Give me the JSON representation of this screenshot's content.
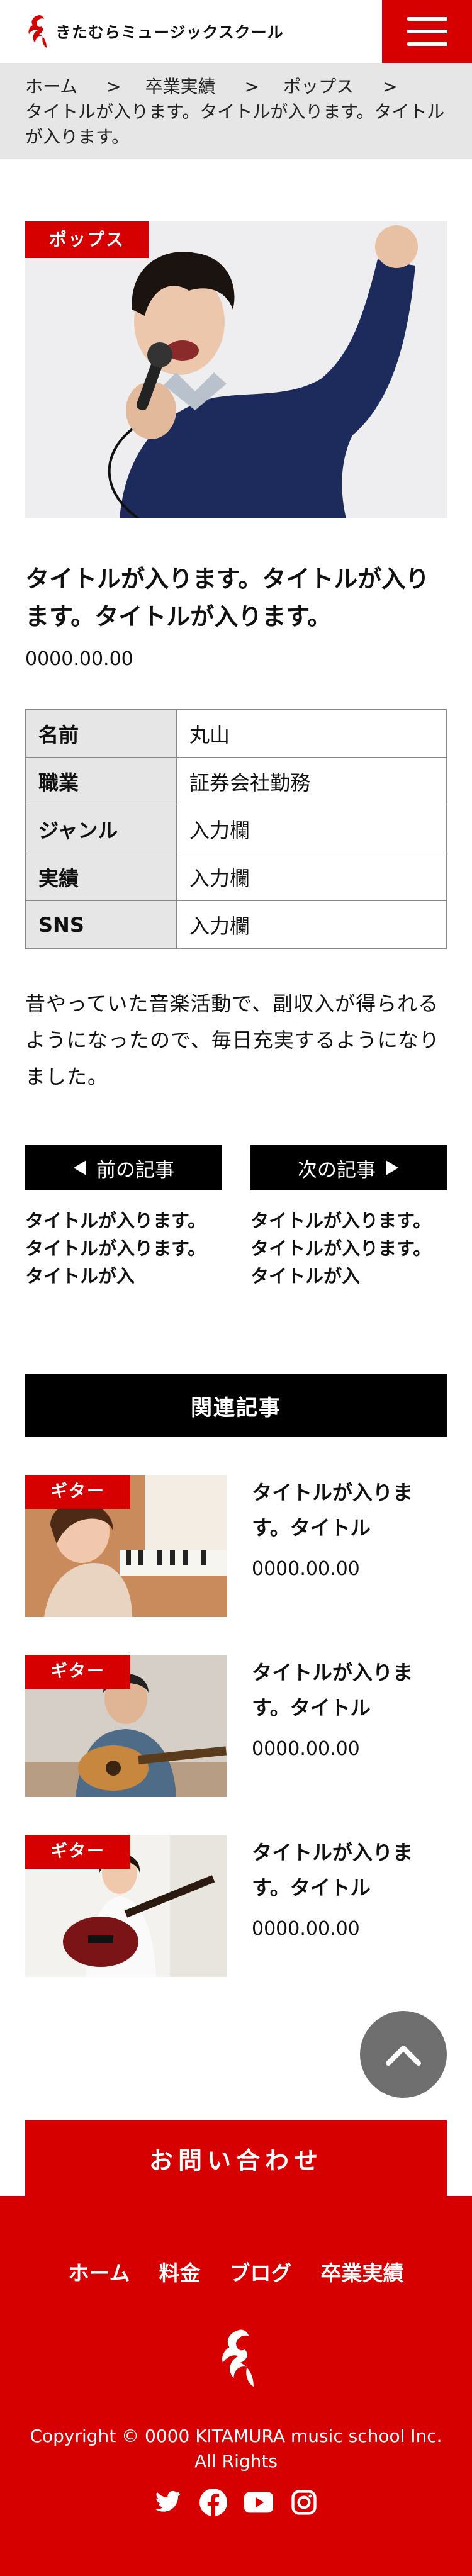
{
  "header": {
    "brand": "きたむらミュージックスクール",
    "menu_icon": "hamburger-icon"
  },
  "breadcrumb": {
    "items": [
      "ホーム",
      "卒業実績",
      "ポップス"
    ],
    "separator": ">",
    "current": "タイトルが入ります。タイトルが入ります。タイトルが入ります。"
  },
  "article": {
    "category": "ポップス",
    "title": "タイトルが入ります。タイトルが入ります。タイトルが入ります。",
    "date": "0000.00.00",
    "profile": [
      {
        "key": "名前",
        "value": "丸山"
      },
      {
        "key": "職業",
        "value": "証券会社勤務"
      },
      {
        "key": "ジャンル",
        "value": "入力欄"
      },
      {
        "key": "実績",
        "value": "入力欄"
      },
      {
        "key": "SNS",
        "value": "入力欄"
      }
    ],
    "body": "昔やっていた音楽活動で、副収入が得られるようになったので、毎日充実するようになりました。"
  },
  "pager": {
    "prev_label": "前の記事",
    "next_label": "次の記事",
    "prev_title": "タイトルが入ります。タイトルが入ります。タイトルが入",
    "next_title": "タイトルが入ります。タイトルが入ります。タイトルが入"
  },
  "related": {
    "heading": "関連記事",
    "items": [
      {
        "tag": "ギター",
        "title": "タイトルが入ります。タイトル",
        "date": "0000.00.00"
      },
      {
        "tag": "ギター",
        "title": "タイトルが入ります。タイトル",
        "date": "0000.00.00"
      },
      {
        "tag": "ギター",
        "title": "タイトルが入ります。タイトル",
        "date": "0000.00.00"
      }
    ]
  },
  "contact": {
    "label": "お問い合わせ"
  },
  "footer": {
    "nav": [
      "ホーム",
      "料金",
      "ブログ",
      "卒業実績"
    ],
    "copyright": "Copyright © 0000 KITAMURA music school Inc. All Rights",
    "social": [
      "twitter-icon",
      "facebook-icon",
      "youtube-icon",
      "instagram-icon"
    ]
  },
  "colors": {
    "accent": "#d60000",
    "dark": "#000000",
    "gray": "#e6e6e6"
  }
}
